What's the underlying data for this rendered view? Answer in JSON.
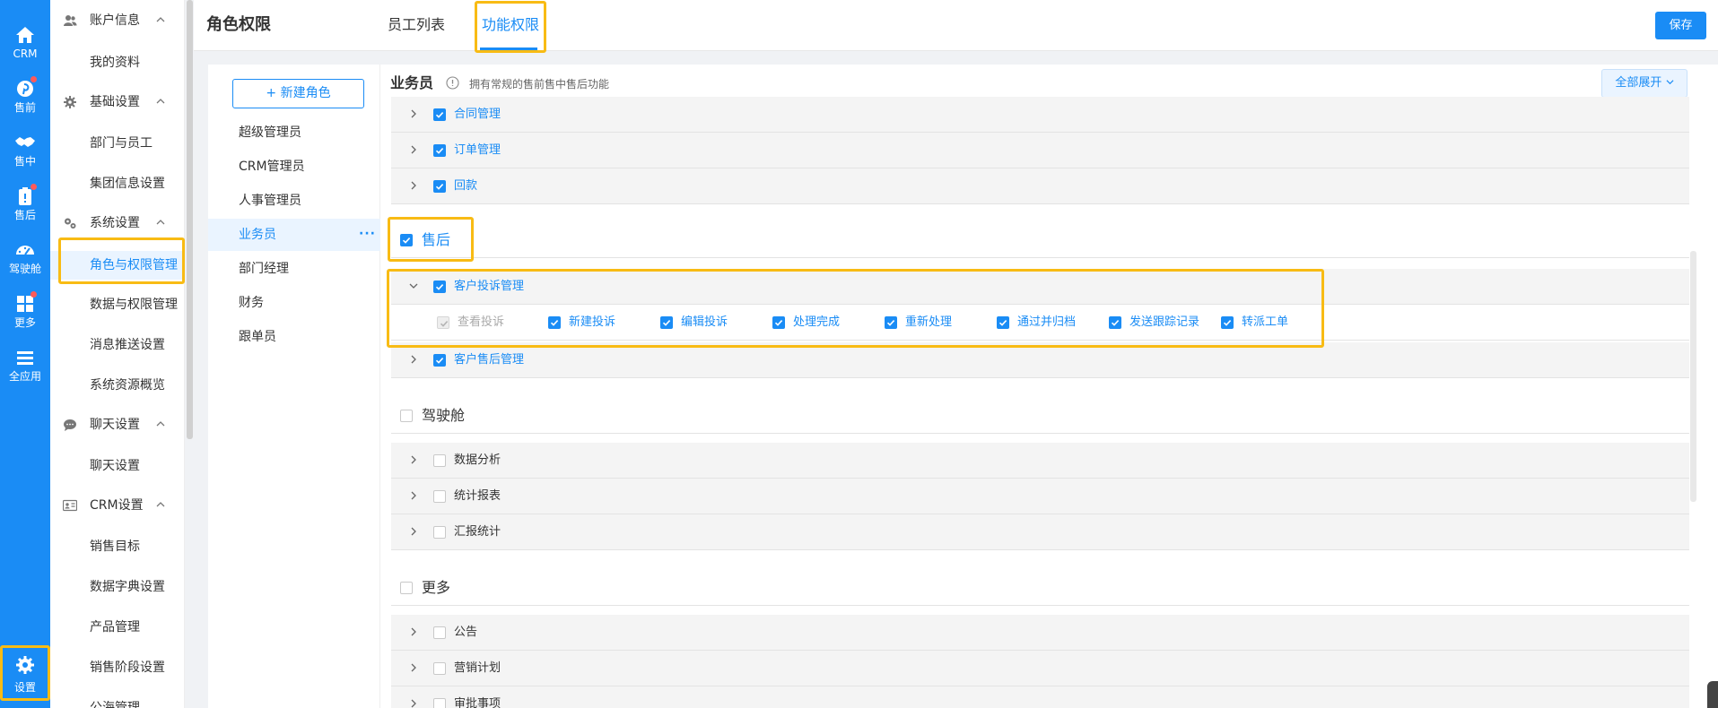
{
  "app_nav": [
    {
      "label": "CRM",
      "icon": "home-icon",
      "badge": false
    },
    {
      "label": "售前",
      "icon": "pinterest-icon",
      "badge": true
    },
    {
      "label": "售中",
      "icon": "handshake-icon",
      "badge": false
    },
    {
      "label": "售后",
      "icon": "clipboard-icon",
      "badge": true
    },
    {
      "label": "驾驶舱",
      "icon": "dashboard-icon",
      "badge": false
    },
    {
      "label": "更多",
      "icon": "grid-icon",
      "badge": true
    },
    {
      "label": "全应用",
      "icon": "menu-icon",
      "badge": false
    },
    {
      "label": "设置",
      "icon": "gear-icon",
      "badge": false,
      "highlighted": true
    }
  ],
  "sidebar": {
    "groups": [
      {
        "label": "账户信息",
        "icon": "users-icon",
        "items": [
          "我的资料"
        ]
      },
      {
        "label": "基础设置",
        "icon": "gear-icon",
        "items": [
          "部门与员工",
          "集团信息设置"
        ]
      },
      {
        "label": "系统设置",
        "icon": "gears-icon",
        "items": [
          "角色与权限管理",
          "数据与权限管理",
          "消息推送设置",
          "系统资源概览"
        ]
      },
      {
        "label": "聊天设置",
        "icon": "chat-icon",
        "items": [
          "聊天设置"
        ]
      },
      {
        "label": "CRM设置",
        "icon": "id-card-icon",
        "items": [
          "销售目标",
          "数据字典设置",
          "产品管理",
          "销售阶段设置",
          "公海管理"
        ]
      }
    ],
    "active_item": "角色与权限管理"
  },
  "header": {
    "title": "角色权限",
    "tabs": [
      {
        "label": "员工列表",
        "active": false
      },
      {
        "label": "功能权限",
        "active": true
      }
    ],
    "save_label": "保存"
  },
  "roles": {
    "new_role_label": "+ 新建角色",
    "items": [
      "超级管理员",
      "CRM管理员",
      "人事管理员",
      "业务员",
      "部门经理",
      "财务",
      "跟单员"
    ],
    "active": "业务员",
    "more_icon": "ellipsis-icon"
  },
  "permissions": {
    "role_title": "业务员",
    "role_desc": "拥有常规的售前售中售后功能",
    "expand_all_label": "全部展开",
    "sections": [
      {
        "label": null,
        "modules": [
          {
            "label": "合同管理",
            "checked": true
          },
          {
            "label": "订单管理",
            "checked": true
          },
          {
            "label": "回款",
            "checked": true
          }
        ]
      },
      {
        "label": "售后",
        "checked": true,
        "modules": [
          {
            "label": "客户投诉管理",
            "checked": true,
            "expanded": true,
            "sub": [
              {
                "label": "查看投诉",
                "checked": true,
                "disabled": true
              },
              {
                "label": "新建投诉",
                "checked": true
              },
              {
                "label": "编辑投诉",
                "checked": true
              },
              {
                "label": "处理完成",
                "checked": true
              },
              {
                "label": "重新处理",
                "checked": true
              },
              {
                "label": "通过并归档",
                "checked": true
              },
              {
                "label": "发送跟踪记录",
                "checked": true
              },
              {
                "label": "转派工单",
                "checked": true
              }
            ]
          },
          {
            "label": "客户售后管理",
            "checked": true
          }
        ]
      },
      {
        "label": "驾驶舱",
        "checked": false,
        "modules": [
          {
            "label": "数据分析",
            "checked": false
          },
          {
            "label": "统计报表",
            "checked": false
          },
          {
            "label": "汇报统计",
            "checked": false
          }
        ]
      },
      {
        "label": "更多",
        "checked": false,
        "modules": [
          {
            "label": "公告",
            "checked": false
          },
          {
            "label": "营销计划",
            "checked": false
          },
          {
            "label": "审批事项",
            "checked": false
          }
        ]
      }
    ]
  },
  "colors": {
    "primary": "#1a8cf5",
    "highlight": "#f8bb14",
    "badge": "#ff5a5a"
  }
}
